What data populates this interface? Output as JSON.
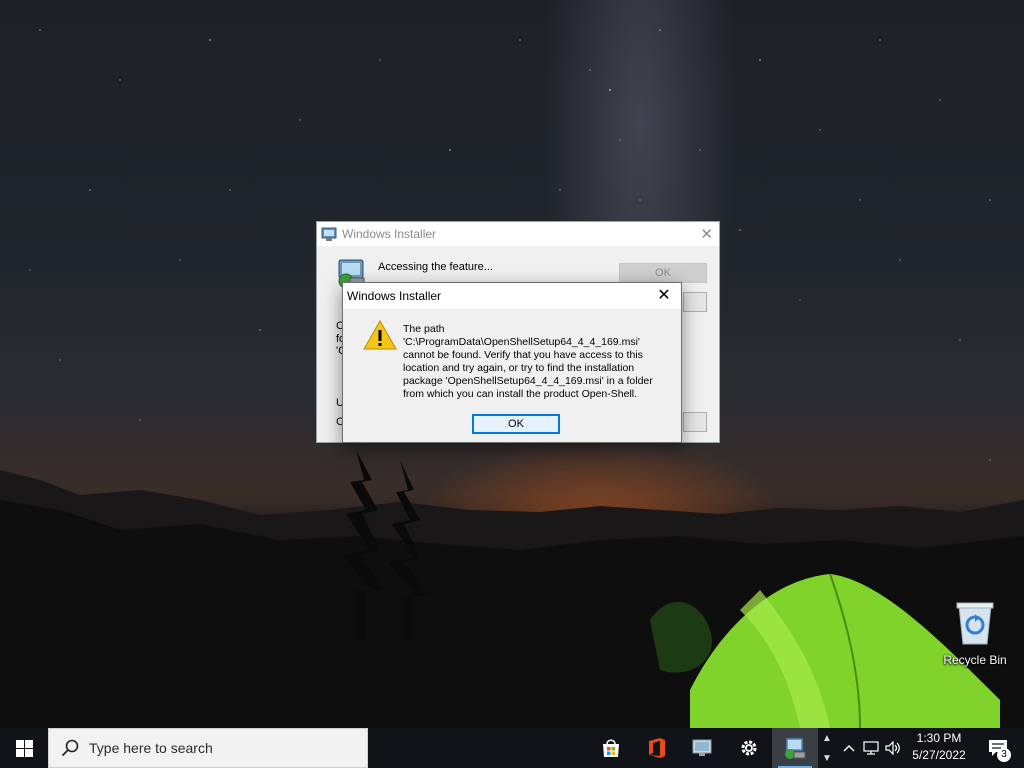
{
  "desktop": {
    "recycle_bin_label": "Recycle Bin"
  },
  "back_dialog": {
    "title": "Windows Installer",
    "status_text": "Accessing the feature...",
    "ok_label": "OK",
    "fragments": [
      "C",
      "fo",
      "'C",
      "U",
      "C"
    ]
  },
  "error_dialog": {
    "title": "Windows Installer",
    "message_lines": [
      "The path",
      "'C:\\ProgramData\\OpenShellSetup64_4_4_169.msi'",
      "cannot be found. Verify that you have access to this",
      "location and try again, or try to find the installation",
      "package 'OpenShellSetup64_4_4_169.msi' in a folder",
      "from which you can install the product Open-Shell."
    ],
    "ok_label": "OK",
    "close_glyph": "✕"
  },
  "taskbar": {
    "search_placeholder": "Type here to search",
    "apps": [
      "store-icon",
      "office-icon",
      "installer-app-icon",
      "settings-icon",
      "windows-installer-icon"
    ],
    "tray_chevron": "^",
    "clock_time": "1:30 PM",
    "clock_date": "5/27/2022",
    "notification_count": "3"
  },
  "colors": {
    "accent": "#0078d7",
    "taskbar": "#101418",
    "dialog_bg": "#f0f0f0"
  }
}
